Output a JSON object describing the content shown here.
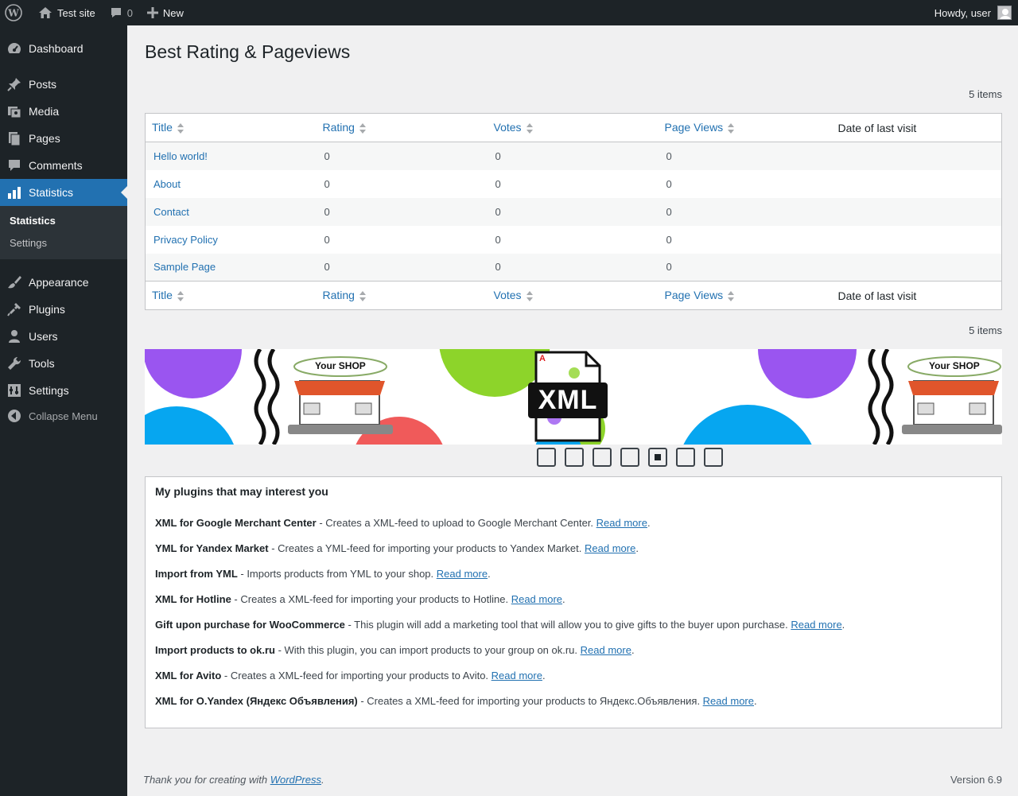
{
  "adminbar": {
    "site_name": "Test site",
    "comments_count": "0",
    "new_label": "New",
    "howdy": "Howdy, user"
  },
  "sidebar": {
    "items": [
      {
        "label": "Dashboard",
        "icon": "dashboard-icon"
      },
      {
        "label": "Posts",
        "icon": "pin-icon"
      },
      {
        "label": "Media",
        "icon": "media-icon"
      },
      {
        "label": "Pages",
        "icon": "pages-icon"
      },
      {
        "label": "Comments",
        "icon": "comment-icon"
      },
      {
        "label": "Statistics",
        "icon": "chart-bar-icon"
      },
      {
        "label": "Appearance",
        "icon": "brush-icon"
      },
      {
        "label": "Plugins",
        "icon": "plug-icon"
      },
      {
        "label": "Users",
        "icon": "user-icon"
      },
      {
        "label": "Tools",
        "icon": "wrench-icon"
      },
      {
        "label": "Settings",
        "icon": "settings-icon"
      }
    ],
    "submenu": [
      "Statistics",
      "Settings"
    ],
    "collapse_label": "Collapse Menu"
  },
  "page": {
    "title": "Best Rating & Pageviews",
    "items_count": "5 items"
  },
  "table": {
    "columns": [
      "Title",
      "Rating",
      "Votes",
      "Page Views",
      "Date of last visit"
    ],
    "rows": [
      {
        "title": "Hello world!",
        "rating": "0",
        "votes": "0",
        "views": "0",
        "date": ""
      },
      {
        "title": "About",
        "rating": "0",
        "votes": "0",
        "views": "0",
        "date": ""
      },
      {
        "title": "Contact",
        "rating": "0",
        "votes": "0",
        "views": "0",
        "date": ""
      },
      {
        "title": "Privacy Policy",
        "rating": "0",
        "votes": "0",
        "views": "0",
        "date": ""
      },
      {
        "title": "Sample Page",
        "rating": "0",
        "votes": "0",
        "views": "0",
        "date": ""
      }
    ]
  },
  "banner": {
    "shop_label": "Your SHOP",
    "xml_label": "XML",
    "corner_letter": "A"
  },
  "plugins": {
    "heading": "My plugins that may interest you",
    "read_more": "Read more",
    "items": [
      {
        "name": "XML for Google Merchant Center",
        "desc": " - Creates a XML-feed to upload to Google Merchant Center. "
      },
      {
        "name": "YML for Yandex Market",
        "desc": " - Creates a YML-feed for importing your products to Yandex Market. "
      },
      {
        "name": "Import from YML",
        "desc": " - Imports products from YML to your shop. "
      },
      {
        "name": "XML for Hotline",
        "desc": " - Creates a XML-feed for importing your products to Hotline. "
      },
      {
        "name": "Gift upon purchase for WooCommerce",
        "desc": " - This plugin will add a marketing tool that will allow you to give gifts to the buyer upon purchase. "
      },
      {
        "name": "Import products to ok.ru",
        "desc": " - With this plugin, you can import products to your group on ok.ru. "
      },
      {
        "name": "XML for Avito",
        "desc": " - Creates a XML-feed for importing your products to Avito. "
      },
      {
        "name": "XML for O.Yandex (Яндекс Объявления)",
        "desc": " - Creates a XML-feed for importing your products to Яндекс.Объявления. "
      }
    ]
  },
  "footer": {
    "thanks": "Thank you for creating with ",
    "wp_link": "WordPress",
    "version": "Version 6.9"
  }
}
